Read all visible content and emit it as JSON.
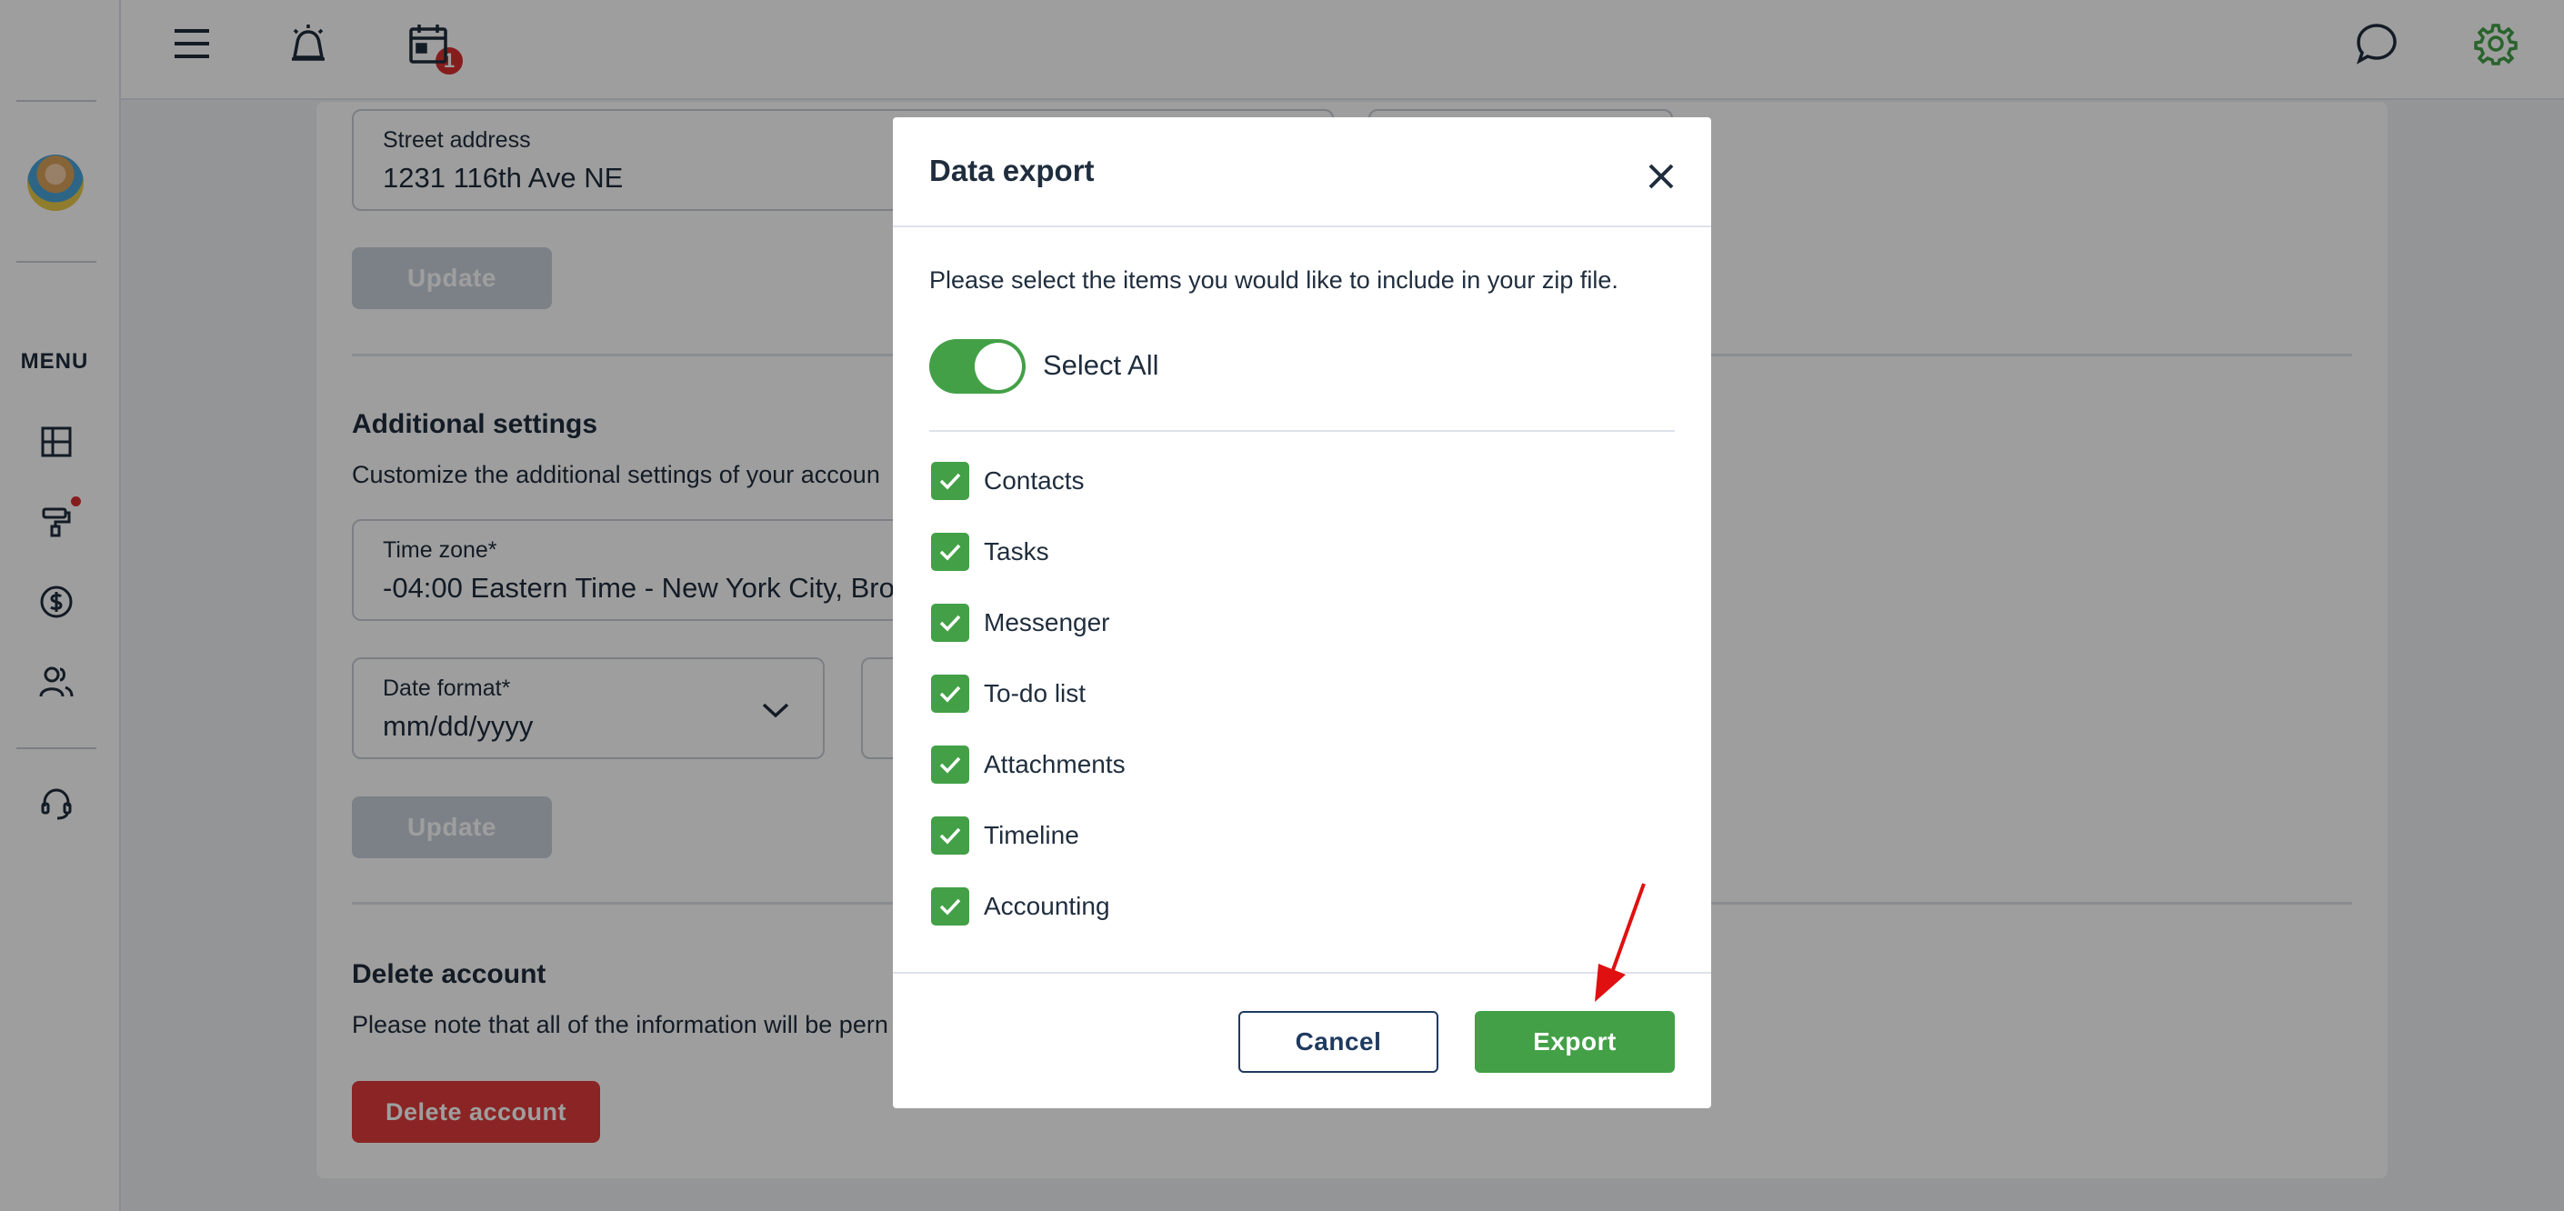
{
  "sidebar": {
    "menu_label": "MENU",
    "icons": [
      "dashboard-icon",
      "paint-roller-icon",
      "dollar-icon",
      "users-icon",
      "headset-icon"
    ]
  },
  "topbar": {
    "notification_count": "1",
    "icons": [
      "hamburger-menu-icon",
      "alarm-icon",
      "calendar-icon",
      "chat-icon",
      "settings-gear-icon"
    ]
  },
  "page": {
    "street_address": {
      "label": "Street address",
      "value": "1231 116th Ave NE"
    },
    "update_label": "Update",
    "additional": {
      "heading": "Additional settings",
      "description": "Customize the additional settings of your accoun",
      "timezone": {
        "label": "Time zone*",
        "value": "-04:00 Eastern Time - New York City, Bro"
      },
      "date_format": {
        "label": "Date format*",
        "value": "mm/dd/yyyy"
      }
    },
    "delete": {
      "heading": "Delete account",
      "description": "Please note that all of the information will be pern",
      "button": "Delete account"
    }
  },
  "modal": {
    "title": "Data export",
    "description": "Please select the items you would like to include in your zip file.",
    "select_all": {
      "label": "Select All",
      "checked": true
    },
    "items": [
      {
        "label": "Contacts",
        "checked": true
      },
      {
        "label": "Tasks",
        "checked": true
      },
      {
        "label": "Messenger",
        "checked": true
      },
      {
        "label": "To-do list",
        "checked": true
      },
      {
        "label": "Attachments",
        "checked": true
      },
      {
        "label": "Timeline",
        "checked": true
      },
      {
        "label": "Accounting",
        "checked": true
      }
    ],
    "cancel_label": "Cancel",
    "export_label": "Export"
  },
  "colors": {
    "accent_green": "#43a047",
    "danger_red": "#e03b3b",
    "annotation_arrow": "#e01010"
  }
}
